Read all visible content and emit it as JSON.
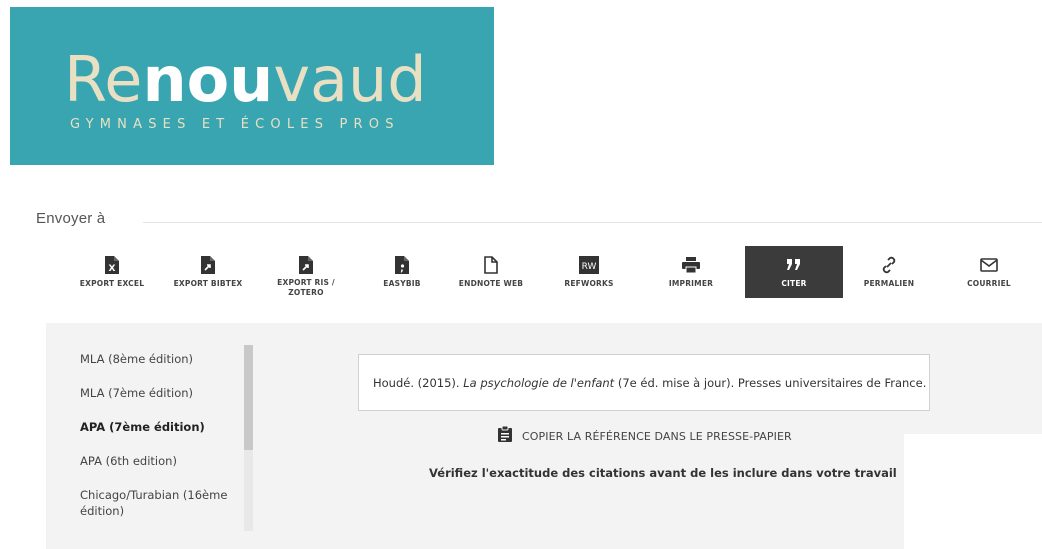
{
  "logo": {
    "brand_prefix": "Re",
    "brand_bold": "nou",
    "brand_suffix": "vaud",
    "tagline": "GYMNASES ET ÉCOLES PROS",
    "background_color": "#38a5b1"
  },
  "send": {
    "title": "Envoyer à"
  },
  "toolbar": {
    "items": [
      {
        "label": "EXPORT EXCEL",
        "icon": "excel-file-icon"
      },
      {
        "label": "EXPORT BIBTEX",
        "icon": "bibtex-file-icon"
      },
      {
        "label": "EXPORT RIS /",
        "label2": "ZOTERO",
        "icon": "ris-file-icon"
      },
      {
        "label": "EASYBIB",
        "icon": "easybib-file-icon"
      },
      {
        "label": "ENDNOTE WEB",
        "icon": "document-icon"
      },
      {
        "label": "REFWORKS",
        "icon": "refworks-icon",
        "badge": "RW"
      },
      {
        "label": "IMPRIMER",
        "icon": "printer-icon"
      },
      {
        "label": "CITER",
        "icon": "quote-icon",
        "active": true
      },
      {
        "label": "PERMALIEN",
        "icon": "link-icon"
      },
      {
        "label": "COURRIEL",
        "icon": "envelope-icon"
      }
    ]
  },
  "citation_styles": [
    {
      "label": "MLA (8ème édition)"
    },
    {
      "label": "MLA (7ème édition)"
    },
    {
      "label": "APA (7ème édition)",
      "active": true
    },
    {
      "label": "APA (6th edition)"
    },
    {
      "label": "Chicago/Turabian (16ème édition)"
    }
  ],
  "citation": {
    "before": "Houdé. (2015). ",
    "title": "La psychologie de l'enfant",
    "after": " (7e éd. mise à jour). Presses universitaires de France."
  },
  "copy_label": "COPIER LA RÉFÉRENCE DANS LE PRESSE-PAPIER",
  "warning": "Vérifiez l'exactitude des citations avant de les inclure dans votre travail",
  "colors": {
    "active_tool_bg": "#3b3b3b",
    "panel_bg": "#f3f3f3"
  }
}
